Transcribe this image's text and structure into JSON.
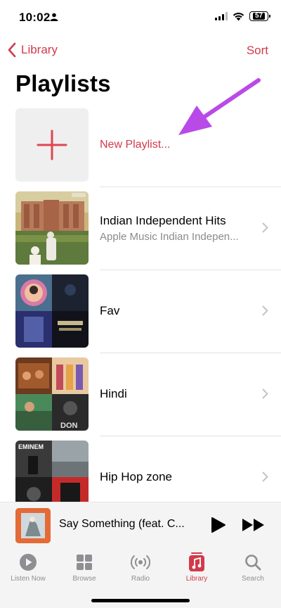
{
  "status_bar": {
    "time": "10:02",
    "battery": "57"
  },
  "nav": {
    "back_label": "Library",
    "sort_label": "Sort"
  },
  "page": {
    "title": "Playlists"
  },
  "playlists": [
    {
      "title": "New Playlist...",
      "subtitle": ""
    },
    {
      "title": "Indian Independent Hits",
      "subtitle": "Apple Music Indian Indepen..."
    },
    {
      "title": "Fav",
      "subtitle": ""
    },
    {
      "title": "Hindi",
      "subtitle": ""
    },
    {
      "title": "Hip Hop zone",
      "subtitle": ""
    }
  ],
  "artwork_text": {
    "hip_hop_tile": "EMINEM",
    "hindi_tile": "DON"
  },
  "mini_player": {
    "title": "Say Something (feat. C..."
  },
  "tabs": [
    {
      "label": "Listen Now",
      "icon": "play-circle-icon"
    },
    {
      "label": "Browse",
      "icon": "grid-icon"
    },
    {
      "label": "Radio",
      "icon": "radio-waves-icon"
    },
    {
      "label": "Library",
      "icon": "music-note-icon",
      "active": true
    },
    {
      "label": "Search",
      "icon": "search-icon"
    }
  ],
  "colors": {
    "accent": "#d13a4a",
    "annotation": "#b94ae8",
    "secondary_text": "#8a8a8e"
  }
}
